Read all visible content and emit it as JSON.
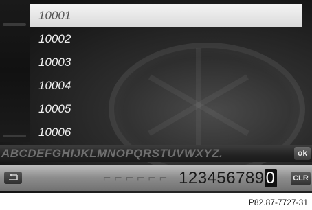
{
  "list": {
    "items": [
      "10001",
      "10002",
      "10003",
      "10004",
      "10005",
      "10006"
    ],
    "selected_index": 0
  },
  "keyboard": {
    "letters": "ABCDEFGHIJKLMNOPQRSTUVWXYZ.",
    "ok_label": "ok",
    "digits": "123456789",
    "selected_digit": "0",
    "clear_label": "CLR",
    "back_icon": "back-arrow-icon"
  },
  "caption": "P82.87-7727-31",
  "colors": {
    "selected_row": "#e6e6e6",
    "screen_background": "#1c1c1c",
    "digit_bar": "#9a9a9a"
  }
}
